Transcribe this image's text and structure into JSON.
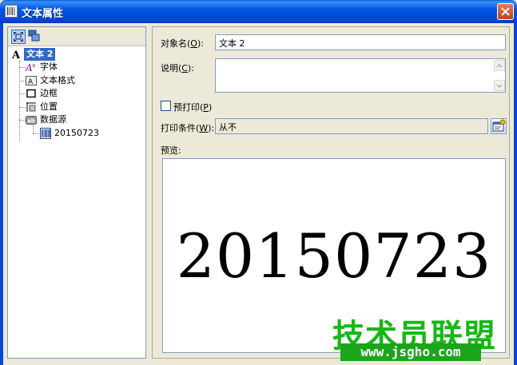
{
  "window": {
    "title": "文本属性"
  },
  "tree": {
    "root": {
      "label": "文本 2",
      "icon": "text-icon"
    },
    "children": [
      {
        "label": "字体",
        "icon": "font-icon"
      },
      {
        "label": "文本格式",
        "icon": "text-format-icon"
      },
      {
        "label": "边框",
        "icon": "border-icon"
      },
      {
        "label": "位置",
        "icon": "position-icon"
      },
      {
        "label": "数据源",
        "icon": "datasource-icon"
      }
    ],
    "datasource_child": {
      "label": "20150723",
      "icon": "barcode-icon"
    }
  },
  "form": {
    "object_name_label": "对象名(",
    "object_name_key": "O",
    "object_name_suffix": "):",
    "object_name_value": "文本 2",
    "description_label": "说明(",
    "description_key": "C",
    "description_suffix": "):",
    "description_value": "",
    "preprint_label": "预打印(",
    "preprint_key": "P",
    "preprint_suffix": ")",
    "preprint_checked": false,
    "print_condition_label": "打印条件(",
    "print_condition_key": "W",
    "print_condition_suffix": "):",
    "print_condition_value": "从不",
    "preview_label": "预览:"
  },
  "preview": {
    "text": "20150723"
  },
  "watermark": {
    "main": "技术员联盟",
    "url": "www.jsgho.com"
  },
  "colors": {
    "titlebar": "#0055e5",
    "selection": "#316ac5",
    "watermark_green": "#16b816"
  }
}
